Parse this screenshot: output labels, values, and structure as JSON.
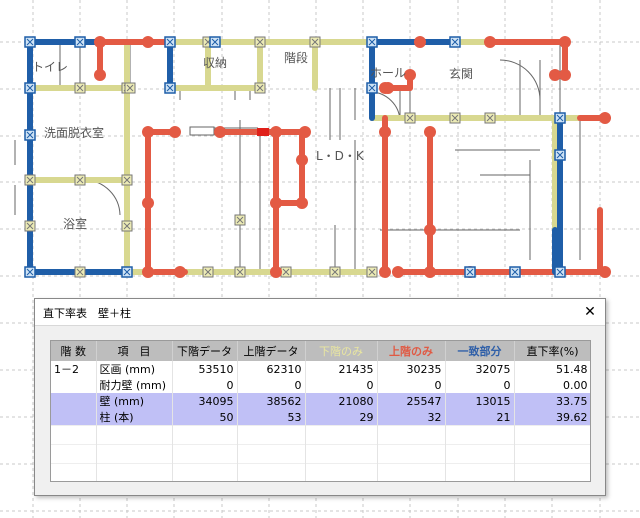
{
  "floor_plan": {
    "rooms": [
      {
        "id": "toilet",
        "label": "トイレ"
      },
      {
        "id": "storage",
        "label": "収納"
      },
      {
        "id": "stairs",
        "label": "階段"
      },
      {
        "id": "hall",
        "label": "ホール"
      },
      {
        "id": "entrance",
        "label": "玄関"
      },
      {
        "id": "washroom",
        "label": "洗面脱衣室"
      },
      {
        "id": "ldk",
        "label": "L・D・K"
      },
      {
        "id": "bath",
        "label": "浴室"
      }
    ],
    "colors": {
      "common": "#1f5ea8",
      "upper": "#e35a44",
      "lower": "#d8d890",
      "lower_stroke": "#b5b55a",
      "grid": "#c8c8c8",
      "thin": "#666666"
    }
  },
  "dialog": {
    "title": "直下率表　壁＋柱",
    "close_label": "✕",
    "columns": [
      "階 数",
      "項　目",
      "下階データ",
      "上階データ",
      "下階のみ",
      "上階のみ",
      "一致部分",
      "直下率(%)"
    ],
    "rows": [
      {
        "floor": "1－2",
        "item": "区画",
        "unit": "(mm)",
        "lower": "53510",
        "upper": "62310",
        "lower_only": "21435",
        "upper_only": "30235",
        "match": "32075",
        "rate": "51.48",
        "highlight": false
      },
      {
        "floor": "",
        "item": "耐力壁",
        "unit": "(mm)",
        "lower": "0",
        "upper": "0",
        "lower_only": "0",
        "upper_only": "0",
        "match": "0",
        "rate": "0.00",
        "highlight": false
      },
      {
        "floor": "",
        "item": "壁",
        "unit": "(mm)",
        "lower": "34095",
        "upper": "38562",
        "lower_only": "21080",
        "upper_only": "25547",
        "match": "13015",
        "rate": "33.75",
        "highlight": true
      },
      {
        "floor": "",
        "item": "柱",
        "unit": "(本)",
        "lower": "50",
        "upper": "53",
        "lower_only": "29",
        "upper_only": "32",
        "match": "21",
        "rate": "39.62",
        "highlight": true
      }
    ]
  }
}
